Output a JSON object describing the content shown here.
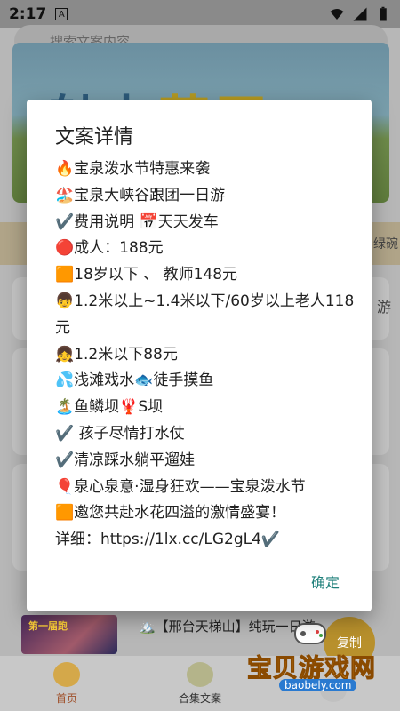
{
  "status_bar": {
    "time": "2:17",
    "notification_badge": "A"
  },
  "search": {
    "placeholder": "搜索文案内容..."
  },
  "banner": {
    "text_a": "魅力",
    "text_b": "草原"
  },
  "strip": {
    "right_text": "绿碗"
  },
  "peek": {
    "right_a": "游"
  },
  "list_item": {
    "thumb_text": "第一届跑",
    "title": "🏔️【邢台天梯山】纯玩一日游"
  },
  "copy_button": {
    "label": "复制"
  },
  "tabs": [
    {
      "label": "首页",
      "active": true
    },
    {
      "label": "合集文案",
      "active": false
    },
    {
      "label": "",
      "active": false
    }
  ],
  "watermark": {
    "main": "宝贝游戏网",
    "url": "baobely.com"
  },
  "dialog": {
    "title": "文案详情",
    "lines": [
      "🔥宝泉泼水节特惠来袭",
      "🏖️宝泉大峡谷跟团一日游",
      "✔️费用说明 📅天天发车",
      "🔴成人：188元",
      "🟧18岁以下 、 教师148元",
      "👦1.2米以上~1.4米以下/60岁以上老人118元",
      "👧1.2米以下88元",
      "💦浅滩戏水🐟徒手摸鱼",
      "🏝️鱼鳞坝🦞S坝",
      "✔️ 孩子尽情打水仗",
      "✔️清凉踩水躺平遛娃",
      "🎈泉心泉意·湿身狂欢——宝泉泼水节",
      "🟧邀您共赴水花四溢的激情盛宴！",
      "详细：https://1lx.cc/LG2gL4✔️"
    ],
    "confirm_label": "确定"
  },
  "colors": {
    "accent": "#1e7f7a",
    "dialog_bg": "#ffffff",
    "scrim": "#8a8a8a"
  }
}
